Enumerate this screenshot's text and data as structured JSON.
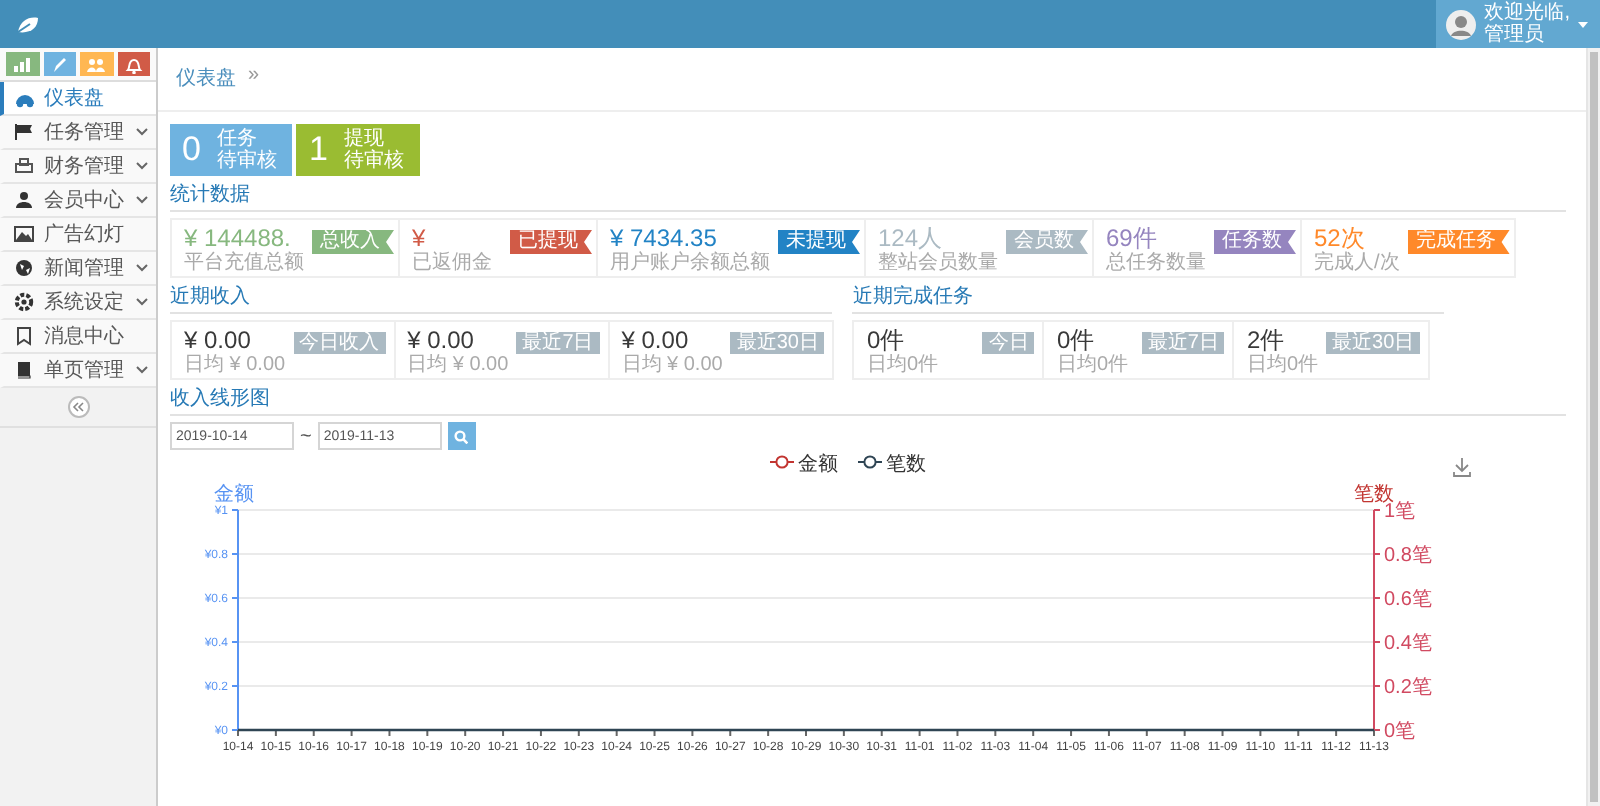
{
  "header": {
    "greeting": "欢迎光临,",
    "user": "管理员"
  },
  "sidebar": {
    "shortcuts": [
      {
        "color": "#87b87f"
      },
      {
        "color": "#6fb3e0"
      },
      {
        "color": "#ffb752"
      },
      {
        "color": "#d15b47"
      }
    ],
    "items": [
      {
        "label": "仪表盘",
        "selected": true,
        "submenu": false
      },
      {
        "label": "任务管理",
        "selected": false,
        "submenu": true
      },
      {
        "label": "财务管理",
        "selected": false,
        "submenu": true
      },
      {
        "label": "会员中心",
        "selected": false,
        "submenu": true
      },
      {
        "label": "广告幻灯",
        "selected": false,
        "submenu": false
      },
      {
        "label": "新闻管理",
        "selected": false,
        "submenu": true
      },
      {
        "label": "系统设定",
        "selected": false,
        "submenu": true
      },
      {
        "label": "消息中心",
        "selected": false,
        "submenu": false
      },
      {
        "label": "单页管理",
        "selected": false,
        "submenu": true
      }
    ]
  },
  "breadcrumb": {
    "label": "仪表盘",
    "separator": "»"
  },
  "pending": [
    {
      "count": "0",
      "title": "任务",
      "status": "待审核",
      "color": "#6fb3e0"
    },
    {
      "count": "1",
      "title": "提现",
      "status": "待审核",
      "color": "#9abc32"
    }
  ],
  "stats": {
    "title": "统计数据",
    "items": [
      {
        "value": "¥ 144488.",
        "badge": "总收入",
        "caption": "平台充值总额",
        "color": "#87b87f"
      },
      {
        "value": "¥",
        "badge": "已提现",
        "caption": "已返佣金",
        "color": "#d15b47"
      },
      {
        "value": "¥ 7434.35",
        "badge": "未提现",
        "caption": "用户账户余额总额",
        "color": "#2283c5"
      },
      {
        "value": "124人",
        "badge": "会员数",
        "caption": "整站会员数量",
        "color": "#abbac3"
      },
      {
        "value": "69件",
        "badge": "任务数",
        "caption": "总任务数量",
        "color": "#9585bf"
      },
      {
        "value": "52次",
        "badge": "完成任务",
        "caption": "完成人/次",
        "color": "#ff892a"
      }
    ]
  },
  "recent_income": {
    "title": "近期收入",
    "items": [
      {
        "value": "¥ 0.00",
        "badge": "今日收入",
        "caption": "日均 ¥ 0.00"
      },
      {
        "value": "¥ 0.00",
        "badge": "最近7日",
        "caption": "日均 ¥ 0.00"
      },
      {
        "value": "¥ 0.00",
        "badge": "最近30日",
        "caption": "日均 ¥ 0.00"
      }
    ]
  },
  "recent_tasks": {
    "title": "近期完成任务",
    "items": [
      {
        "value": "0件",
        "badge": "今日",
        "caption": "日均0件"
      },
      {
        "value": "0件",
        "badge": "最近7日",
        "caption": "日均0件"
      },
      {
        "value": "2件",
        "badge": "最近30日",
        "caption": "日均0件"
      }
    ]
  },
  "chart": {
    "title": "收入线形图",
    "date_from": "2019-10-14",
    "separator": "~",
    "date_to": "2019-11-13",
    "right_axis": {
      "label": "笔数",
      "ticks": [
        "1笔",
        "0.8笔",
        "0.6笔",
        "0.4笔",
        "0.2笔",
        "0笔"
      ]
    },
    "chart_data": {
      "type": "line",
      "ylabel": "金额",
      "ylim": [
        0,
        1
      ],
      "grid": true,
      "legend": true,
      "yticks": [
        {
          "value": 0,
          "label": "¥0"
        },
        {
          "value": 0.2,
          "label": "¥0.2"
        },
        {
          "value": 0.4,
          "label": "¥0.4"
        },
        {
          "value": 0.6,
          "label": "¥0.6"
        },
        {
          "value": 0.8,
          "label": "¥0.8"
        },
        {
          "value": 1,
          "label": "¥1"
        }
      ],
      "categories": [
        "10-14",
        "10-15",
        "10-16",
        "10-17",
        "10-18",
        "10-19",
        "10-20",
        "10-21",
        "10-22",
        "10-23",
        "10-24",
        "10-25",
        "10-26",
        "10-27",
        "10-28",
        "10-29",
        "10-30",
        "10-31",
        "11-01",
        "11-02",
        "11-03",
        "11-04",
        "11-05",
        "11-06",
        "11-07",
        "11-08",
        "11-09",
        "11-10",
        "11-11",
        "11-12",
        "11-13"
      ],
      "series": [
        {
          "name": "金额",
          "color": "#c23531",
          "values": [
            null,
            null,
            null,
            null,
            null,
            null,
            null,
            null,
            null,
            null,
            null,
            null,
            null,
            null,
            null,
            null,
            null,
            null,
            null,
            null,
            null,
            null,
            null,
            null,
            null,
            null,
            null,
            null,
            null,
            null,
            null
          ]
        },
        {
          "name": "笔数",
          "color": "#2f4554",
          "values": [
            0,
            0,
            0,
            0,
            0,
            0,
            0,
            0,
            0,
            0,
            0,
            0,
            0,
            0,
            0,
            0,
            0,
            0,
            0,
            0,
            0,
            0,
            0,
            0,
            0,
            0,
            0,
            0,
            0,
            0,
            0
          ]
        }
      ]
    }
  }
}
